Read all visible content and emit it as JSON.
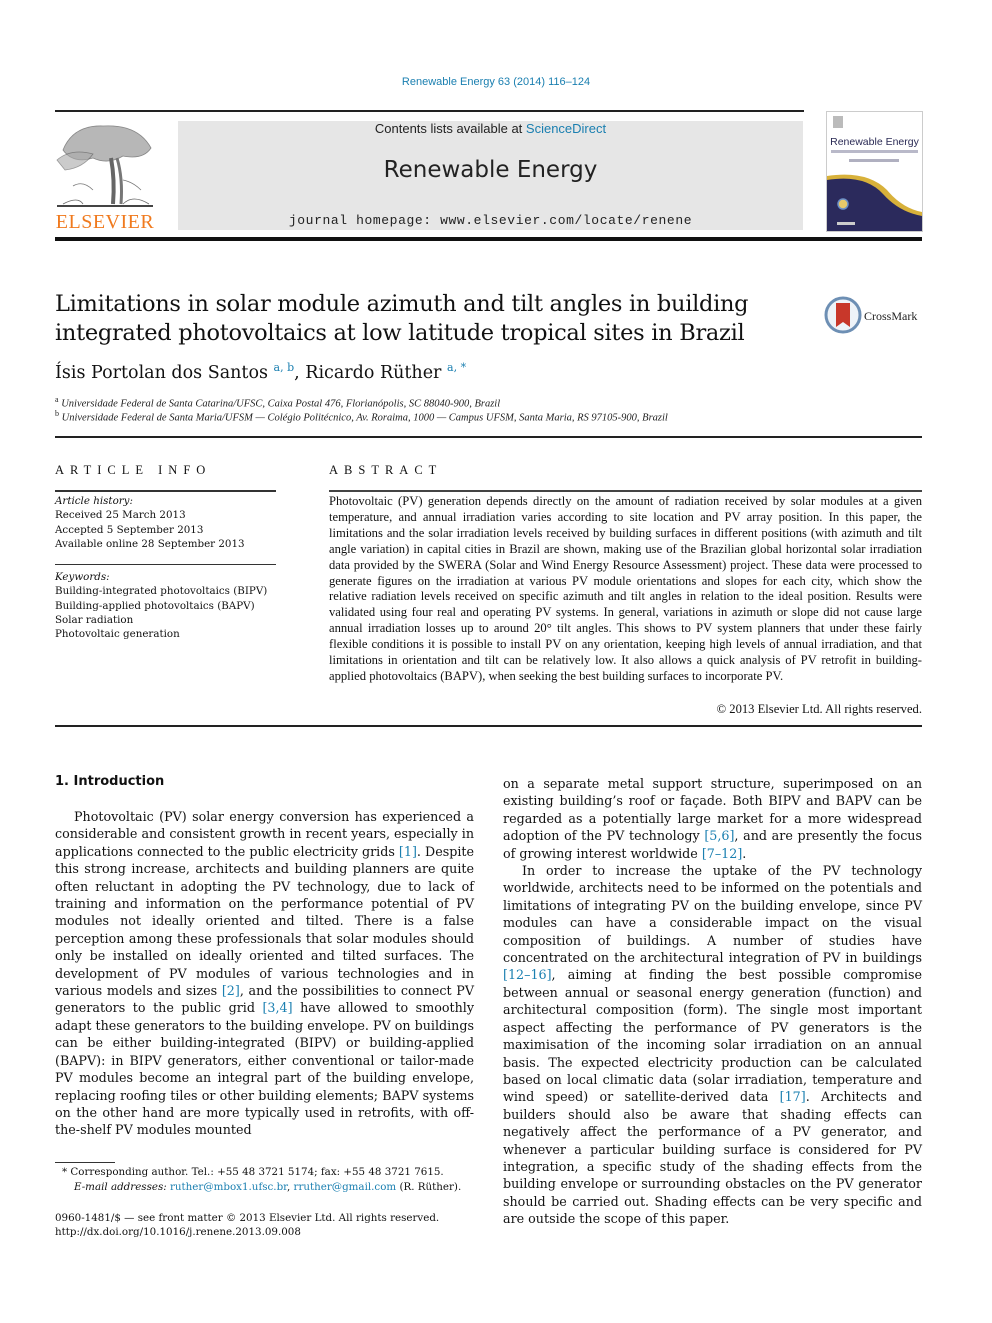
{
  "header": {
    "journal_ref": "Renewable Energy 63 (2014) 116–124",
    "publisher": "ELSEVIER",
    "contents_prefix": "Contents lists available at ",
    "contents_link": "ScienceDirect",
    "journal_name": "Renewable Energy",
    "homepage": "journal homepage: www.elsevier.com/locate/renene",
    "cover_title": "Renewable Energy",
    "crossmark": "CrossMark"
  },
  "article": {
    "title_line1": "Limitations in solar module azimuth and tilt angles in building",
    "title_line2": "integrated photovoltaics at low latitude tropical sites in Brazil",
    "authors": [
      {
        "name": "Ísis Portolan dos Santos",
        "sup": "a, b"
      },
      {
        "name": "Ricardo Rüther",
        "sup": "a, *"
      }
    ],
    "affiliations": [
      {
        "mark": "a",
        "text": "Universidade Federal de Santa Catarina/UFSC, Caixa Postal 476, Florianópolis, SC 88040-900, Brazil"
      },
      {
        "mark": "b",
        "text": "Universidade Federal de Santa Maria/UFSM — Colégio Politécnico, Av. Roraima, 1000 — Campus UFSM, Santa Maria, RS 97105-900, Brazil"
      }
    ]
  },
  "article_info": {
    "heading": "ARTICLE INFO",
    "history_label": "Article history:",
    "received": "Received 25 March 2013",
    "accepted": "Accepted 5 September 2013",
    "online": "Available online 28 September 2013",
    "keywords_label": "Keywords:",
    "keywords": [
      "Building-integrated photovoltaics (BIPV)",
      "Building-applied photovoltaics (BAPV)",
      "Solar radiation",
      "Photovoltaic generation"
    ]
  },
  "abstract": {
    "heading": "ABSTRACT",
    "text": "Photovoltaic (PV) generation depends directly on the amount of radiation received by solar modules at a given temperature, and annual irradiation varies according to site location and PV array position. In this paper, the limitations and the solar irradiation levels received by building surfaces in different positions (with azimuth and tilt angle variation) in capital cities in Brazil are shown, making use of the Brazilian global horizontal solar irradiation data provided by the SWERA (Solar and Wind Energy Resource Assessment) project. These data were processed to generate figures on the irradiation at various PV module orientations and slopes for each city, which show the relative radiation levels received on specific azimuth and tilt angles in relation to the ideal position. Results were validated using four real and operating PV systems. In general, variations in azimuth or slope did not cause large annual irradiation losses up to around 20° tilt angles. This shows to PV system planners that under these fairly flexible conditions it is possible to install PV on any orientation, keeping high levels of annual irradiation, and that limitations in orientation and tilt can be relatively low. It also allows a quick analysis of PV retrofit in building-applied photovoltaics (BAPV), when seeking the best building surfaces to incorporate PV.",
    "copyright": "© 2013 Elsevier Ltd. All rights reserved."
  },
  "body": {
    "section_heading": "1.  Introduction",
    "left_p1": [
      {
        "t": "Photovoltaic (PV) solar energy conversion has experienced a considerable and consistent growth in recent years, especially in applications connected to the public electricity grids "
      },
      {
        "ref": "[1]"
      },
      {
        "t": ". Despite this strong increase, architects and building planners are quite often reluctant in adopting the PV technology, due to lack of training and information on the performance potential of PV modules not ideally oriented and tilted. There is a false perception among these professionals that solar modules should only be installed on ideally oriented and tilted surfaces. The development of PV modules of various technologies and in various models and sizes "
      },
      {
        "ref": "[2]"
      },
      {
        "t": ", and the possibilities to connect PV generators to the public grid "
      },
      {
        "ref": "[3,4]"
      },
      {
        "t": " have allowed to smoothly adapt these generators to the building envelope. PV on buildings can be either building-integrated (BIPV) or building-applied (BAPV): in BIPV generators, either conventional or tailor-made PV modules become an integral part of the building envelope, replacing roofing tiles or other building elements; BAPV systems on the other hand are more typically used in retrofits, with off-the-shelf PV modules mounted"
      }
    ],
    "right_p1": [
      {
        "t": "on a separate metal support structure, superimposed on an existing building’s roof or façade. Both BIPV and BAPV can be regarded as a potentially large market for a more widespread adoption of the PV technology "
      },
      {
        "ref": "[5,6]"
      },
      {
        "t": ", and are presently the focus of growing interest worldwide "
      },
      {
        "ref": "[7–12]"
      },
      {
        "t": "."
      }
    ],
    "right_p2": [
      {
        "t": "In order to increase the uptake of the PV technology worldwide, architects need to be informed on the potentials and limitations of integrating PV on the building envelope, since PV modules can have a considerable impact on the visual composition of buildings. A number of studies have concentrated on the architectural integration of PV in buildings "
      },
      {
        "ref": "[12–16]"
      },
      {
        "t": ", aiming at finding the best possible compromise between annual or seasonal energy generation (function) and architectural composition (form). The single most important aspect affecting the performance of PV generators is the maximisation of the incoming solar irradiation on an annual basis. The expected electricity production can be calculated based on local climatic data (solar irradiation, temperature and wind speed) or satellite-derived data "
      },
      {
        "ref": "[17]"
      },
      {
        "t": ". Architects and builders should also be aware that shading effects can negatively affect the performance of a PV generator, and whenever a particular building surface is considered for PV integration, a specific study of the shading effects from the building envelope or surrounding obstacles on the PV generator should be carried out. Shading effects can be very specific and are outside the scope of this paper."
      }
    ]
  },
  "footnotes": {
    "corresponding": "*  Corresponding author. Tel.: +55 48 3721 5174; fax: +55 48 3721 7615.",
    "email_label": "E-mail addresses: ",
    "email1": "ruther@mbox1.ufsc.br",
    "sep": ", ",
    "email2": "rruther@gmail.com",
    "email_suffix": " (R. Rüther).",
    "issn": "0960-1481/$ — see front matter © 2013 Elsevier Ltd. All rights reserved.",
    "doi": "http://dx.doi.org/10.1016/j.renene.2013.09.008"
  },
  "colors": {
    "link": "#1a7fb0",
    "elsevier_orange": "#f07a1e",
    "banner_bg": "#e6e6e6",
    "cover_navy": "#2b2a5c",
    "cover_gold": "#d8b13a",
    "crossmark_red": "#c8372a"
  }
}
